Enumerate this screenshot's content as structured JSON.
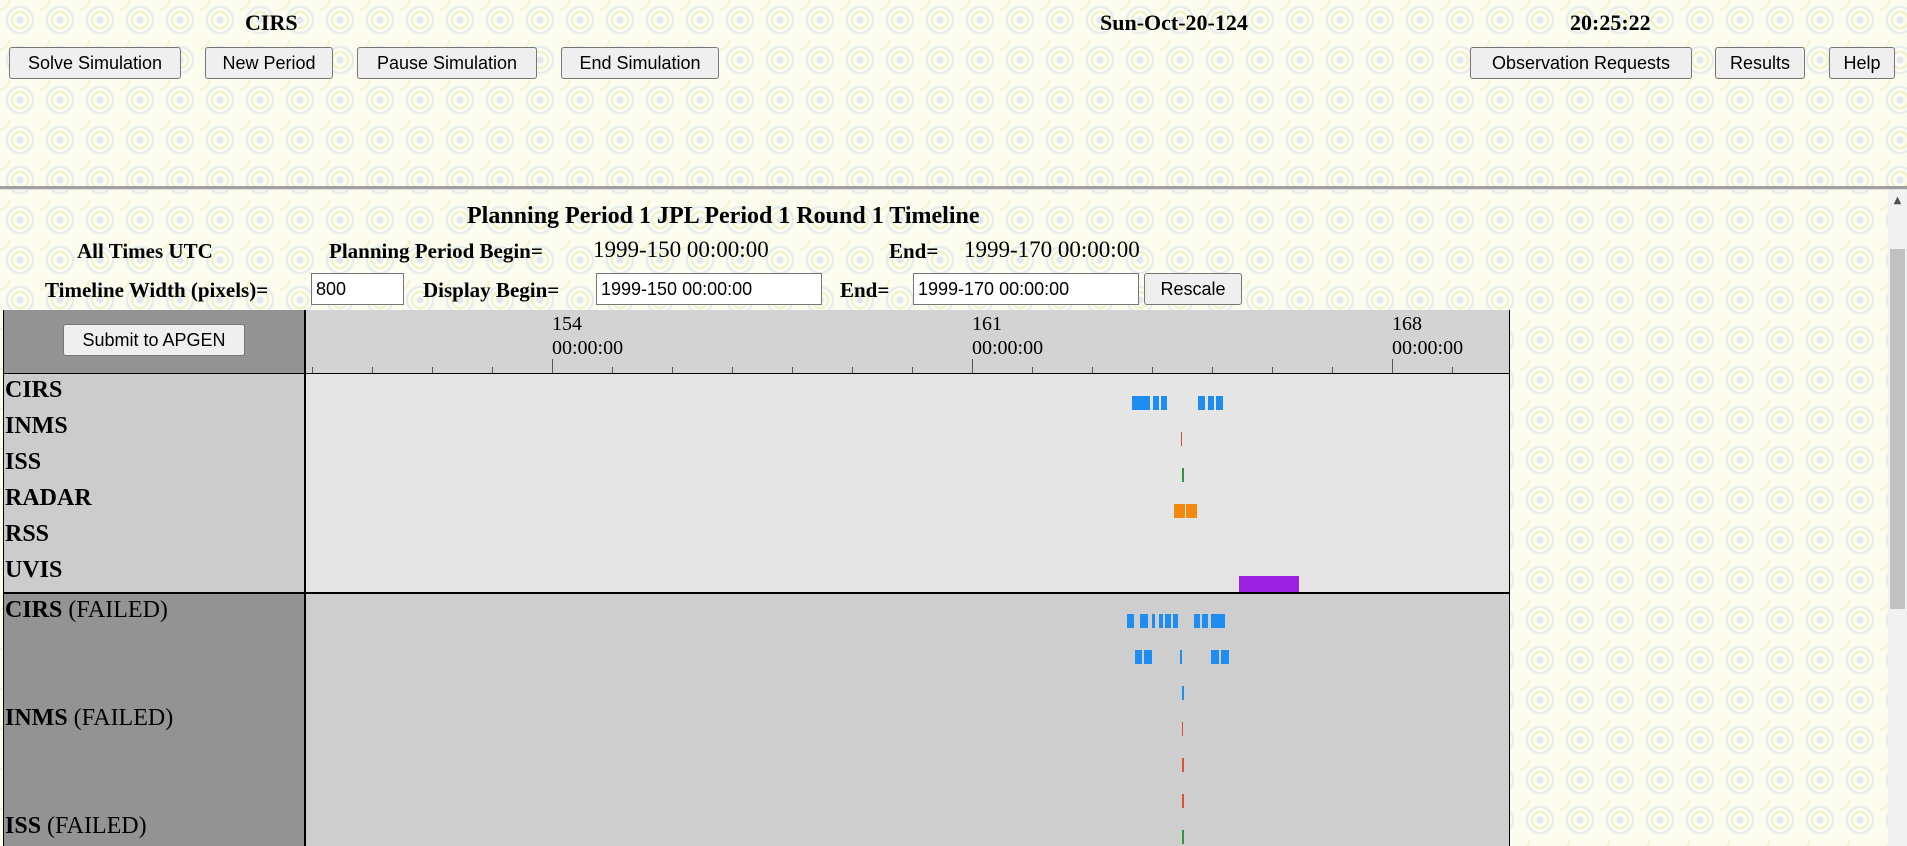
{
  "header": {
    "instrument": "CIRS",
    "date": "Sun-Oct-20-124",
    "time": "20:25:22"
  },
  "toolbar": {
    "solve": "Solve Simulation",
    "new_period": "New Period",
    "pause": "Pause Simulation",
    "end": "End Simulation",
    "observation_requests": "Observation Requests",
    "results": "Results",
    "help": "Help"
  },
  "timeline_panel": {
    "title": "Planning Period 1 JPL Period 1 Round 1 Timeline",
    "all_times": "All Times UTC",
    "period_begin_label": "Planning Period Begin=",
    "period_begin_value": "1999-150 00:00:00",
    "period_end_label": "End=",
    "period_end_value": "1999-170 00:00:00",
    "width_label": "Timeline Width (pixels)=",
    "width_value": "800",
    "display_begin_label": "Display Begin=",
    "display_begin_value": "1999-150 00:00:00",
    "display_end_label": "End=",
    "display_end_value": "1999-170 00:00:00",
    "rescale": "Rescale",
    "submit": "Submit to APGEN"
  },
  "axis": {
    "ticks": [
      {
        "day": "154",
        "time": "00:00:00"
      },
      {
        "day": "161",
        "time": "00:00:00"
      },
      {
        "day": "168",
        "time": "00:00:00"
      }
    ]
  },
  "rows": {
    "scheduled": [
      "CIRS",
      "INMS",
      "ISS",
      "RADAR",
      "RSS",
      "UVIS"
    ],
    "failed": [
      {
        "name": "CIRS",
        "suffix": "(FAILED)"
      },
      {
        "name": "INMS",
        "suffix": "(FAILED)"
      },
      {
        "name": "ISS",
        "suffix": "(FAILED)"
      }
    ]
  },
  "colors": {
    "cirs": "#1e8cf0",
    "inms": "#e05030",
    "iss": "#2a9a3a",
    "radar": "#f08a10",
    "uvis": "#9b22e0"
  }
}
